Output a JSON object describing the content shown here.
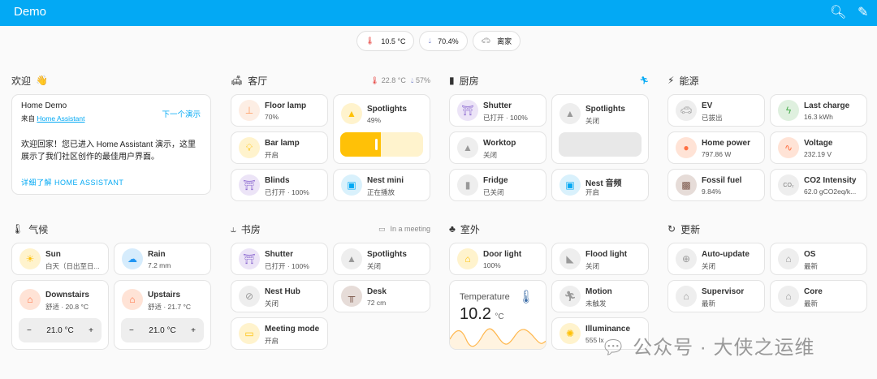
{
  "header": {
    "title": "Demo",
    "search_icon": "search-icon",
    "edit_icon": "pencil-icon"
  },
  "badges": [
    {
      "icon": "thermometer-icon",
      "value": "10.5 °C"
    },
    {
      "icon": "water-drop-icon",
      "value": "70.4%"
    },
    {
      "icon": "car-icon",
      "value": "离家"
    }
  ],
  "welcome": {
    "title": "欢迎",
    "emoji": "👋",
    "card_title": "Home Demo",
    "from_prefix": "来自",
    "from_link": "Home Assistant",
    "next_demo": "下一个演示",
    "body": "欢迎回家！您已进入 Home Assistant 演示，这里展示了我们社区创作的最佳用户界面。",
    "learn_more": "详细了解 HOME ASSISTANT"
  },
  "living": {
    "title": "客厅",
    "temp": "22.8 °C",
    "humidity": "57%",
    "tiles": [
      {
        "name": "Floor lamp",
        "state": "70%"
      },
      {
        "name": "Spotlights",
        "state": "49%",
        "brightness": 49
      },
      {
        "name": "Bar lamp",
        "state": "开启"
      },
      {
        "name": "Blinds",
        "state": "已打开 · 100%"
      },
      {
        "name": "Nest mini",
        "state": "正在播放"
      }
    ]
  },
  "kitchen": {
    "title": "厨房",
    "tiles": [
      {
        "name": "Shutter",
        "state": "已打开 · 100%"
      },
      {
        "name": "Spotlights",
        "state": "关闭",
        "brightness": 0
      },
      {
        "name": "Worktop",
        "state": "关闭"
      },
      {
        "name": "Fridge",
        "state": "已关闭"
      },
      {
        "name": "Nest 音频",
        "state": "开启"
      }
    ]
  },
  "energy": {
    "title": "能源",
    "tiles": [
      {
        "name": "EV",
        "state": "已拔出"
      },
      {
        "name": "Last charge",
        "state": "16.3 kWh"
      },
      {
        "name": "Home power",
        "state": "797.86 W"
      },
      {
        "name": "Voltage",
        "state": "232.19 V"
      },
      {
        "name": "Fossil fuel",
        "state": "9.84%"
      },
      {
        "name": "CO2 Intensity",
        "state": "62.0 gCO2eq/k..."
      }
    ]
  },
  "climate": {
    "title": "气候",
    "tiles": [
      {
        "name": "Sun",
        "state": "白天（日出至日..."
      },
      {
        "name": "Rain",
        "state": "7.2 mm"
      },
      {
        "name": "Downstairs",
        "state": "舒适 · 20.8 °C",
        "target": "21.0 °C"
      },
      {
        "name": "Upstairs",
        "state": "舒适 · 21.7 °C",
        "target": "21.0 °C"
      }
    ],
    "minus": "−",
    "plus": "+"
  },
  "study": {
    "title": "书房",
    "status": "In a meeting",
    "tiles": [
      {
        "name": "Shutter",
        "state": "已打开 · 100%"
      },
      {
        "name": "Spotlights",
        "state": "关闭"
      },
      {
        "name": "Nest Hub",
        "state": "关闭"
      },
      {
        "name": "Desk",
        "state": "72 cm"
      },
      {
        "name": "Meeting mode",
        "state": "开启"
      }
    ]
  },
  "outdoor": {
    "title": "室外",
    "tiles": [
      {
        "name": "Door light",
        "state": "100%"
      },
      {
        "name": "Flood light",
        "state": "关闭"
      },
      {
        "name": "Motion",
        "state": "未触发"
      },
      {
        "name": "Illuminance",
        "state": "555 lx"
      }
    ],
    "temperature": {
      "label": "Temperature",
      "value": "10.2",
      "unit": "°C"
    }
  },
  "updates": {
    "title": "更新",
    "tiles": [
      {
        "name": "Auto-update",
        "state": "关闭"
      },
      {
        "name": "OS",
        "state": "最新"
      },
      {
        "name": "Supervisor",
        "state": "最新"
      },
      {
        "name": "Core",
        "state": "最新"
      }
    ]
  },
  "watermark": "公众号 · 大侠之运维",
  "colors": {
    "header": "#03a9f4",
    "light_on": "#ffc107",
    "cover": "#8e6cd1",
    "energy": "#ff7043"
  }
}
